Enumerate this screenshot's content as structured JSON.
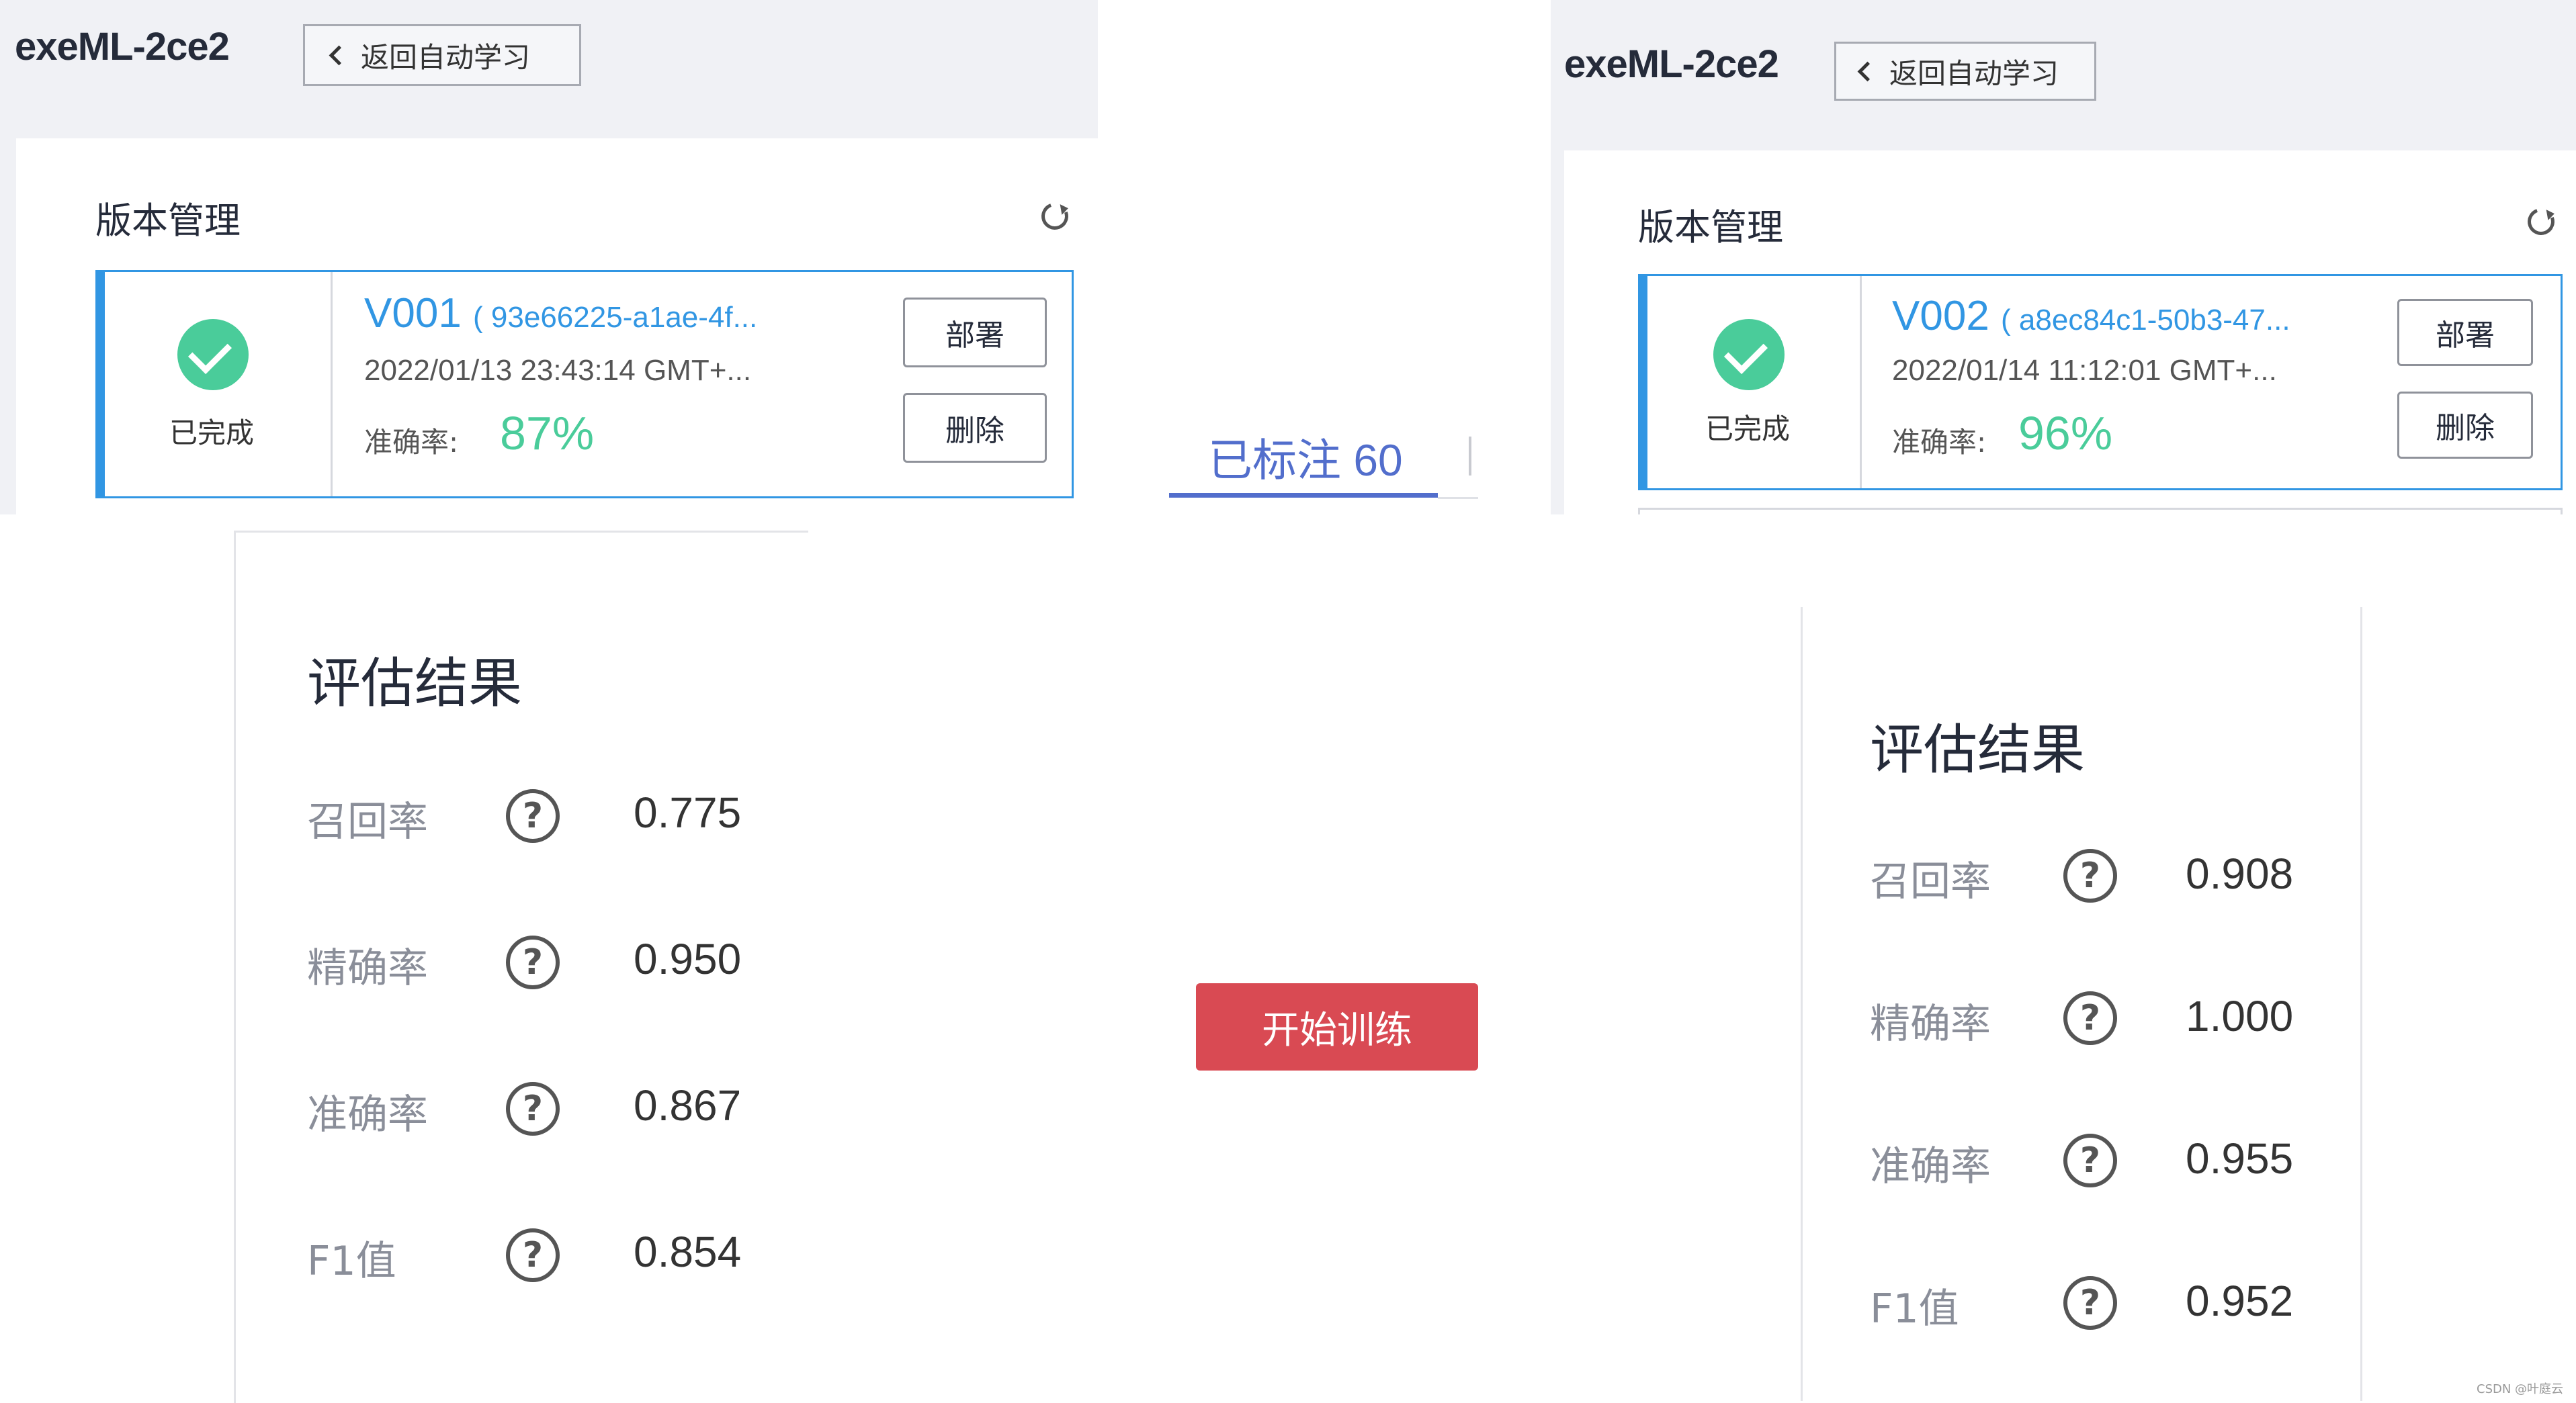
{
  "left_panel": {
    "project_title": "exeML-2ce2",
    "back_label": "返回自动学习",
    "section_title": "版本管理",
    "version": {
      "status": "已完成",
      "name": "V001",
      "id": "( 93e66225-a1ae-4f...",
      "time": "2022/01/13 23:43:14 GMT+...",
      "accuracy_label": "准确率:",
      "accuracy": "87%",
      "deploy": "部署",
      "delete": "删除"
    }
  },
  "right_panel": {
    "project_title": "exeML-2ce2",
    "back_label": "返回自动学习",
    "section_title": "版本管理",
    "version": {
      "status": "已完成",
      "name": "V002",
      "id": "( a8ec84c1-50b3-47...",
      "time": "2022/01/14 11:12:01 GMT+...",
      "accuracy_label": "准确率:",
      "accuracy": "96%",
      "deploy": "部署",
      "delete": "删除"
    }
  },
  "middle": {
    "tab_label": "已标注 60",
    "train_button": "开始训练"
  },
  "eval_left": {
    "title": "评估结果",
    "metrics": [
      {
        "label": "召回率",
        "value": "0.775"
      },
      {
        "label": "精确率",
        "value": "0.950"
      },
      {
        "label": "准确率",
        "value": "0.867"
      },
      {
        "label": "F1值",
        "value": "0.854"
      }
    ]
  },
  "eval_right": {
    "title": "评估结果",
    "metrics": [
      {
        "label": "召回率",
        "value": "0.908"
      },
      {
        "label": "精确率",
        "value": "1.000"
      },
      {
        "label": "准确率",
        "value": "0.955"
      },
      {
        "label": "F1值",
        "value": "0.952"
      }
    ]
  },
  "help_glyph": "?",
  "watermark": "CSDN @叶庭云",
  "colors": {
    "accent_blue": "#3196e3",
    "success_green": "#4acc9a",
    "tab_blue": "#526ecc",
    "train_red": "#d94a53",
    "panel_gray": "#f0f1f5"
  }
}
